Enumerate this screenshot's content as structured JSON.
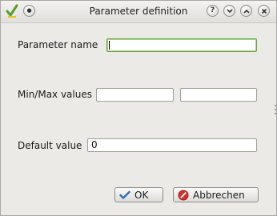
{
  "window": {
    "title": "Parameter definition",
    "title_buttons": [
      "help-icon",
      "minimize-icon",
      "maximize-icon",
      "close-icon"
    ]
  },
  "form": {
    "parameter_name": {
      "label": "Parameter name",
      "value": ""
    },
    "minmax": {
      "label": "Min/Max values",
      "min_value": "",
      "max_value": ""
    },
    "default": {
      "label": "Default value",
      "value": "0"
    }
  },
  "buttons": {
    "ok_label": "OK",
    "cancel_label": "Abbrechen"
  },
  "colors": {
    "focus_border": "#6da046",
    "ok_icon": "#3a72b8",
    "cancel_icon": "#d3302a"
  }
}
